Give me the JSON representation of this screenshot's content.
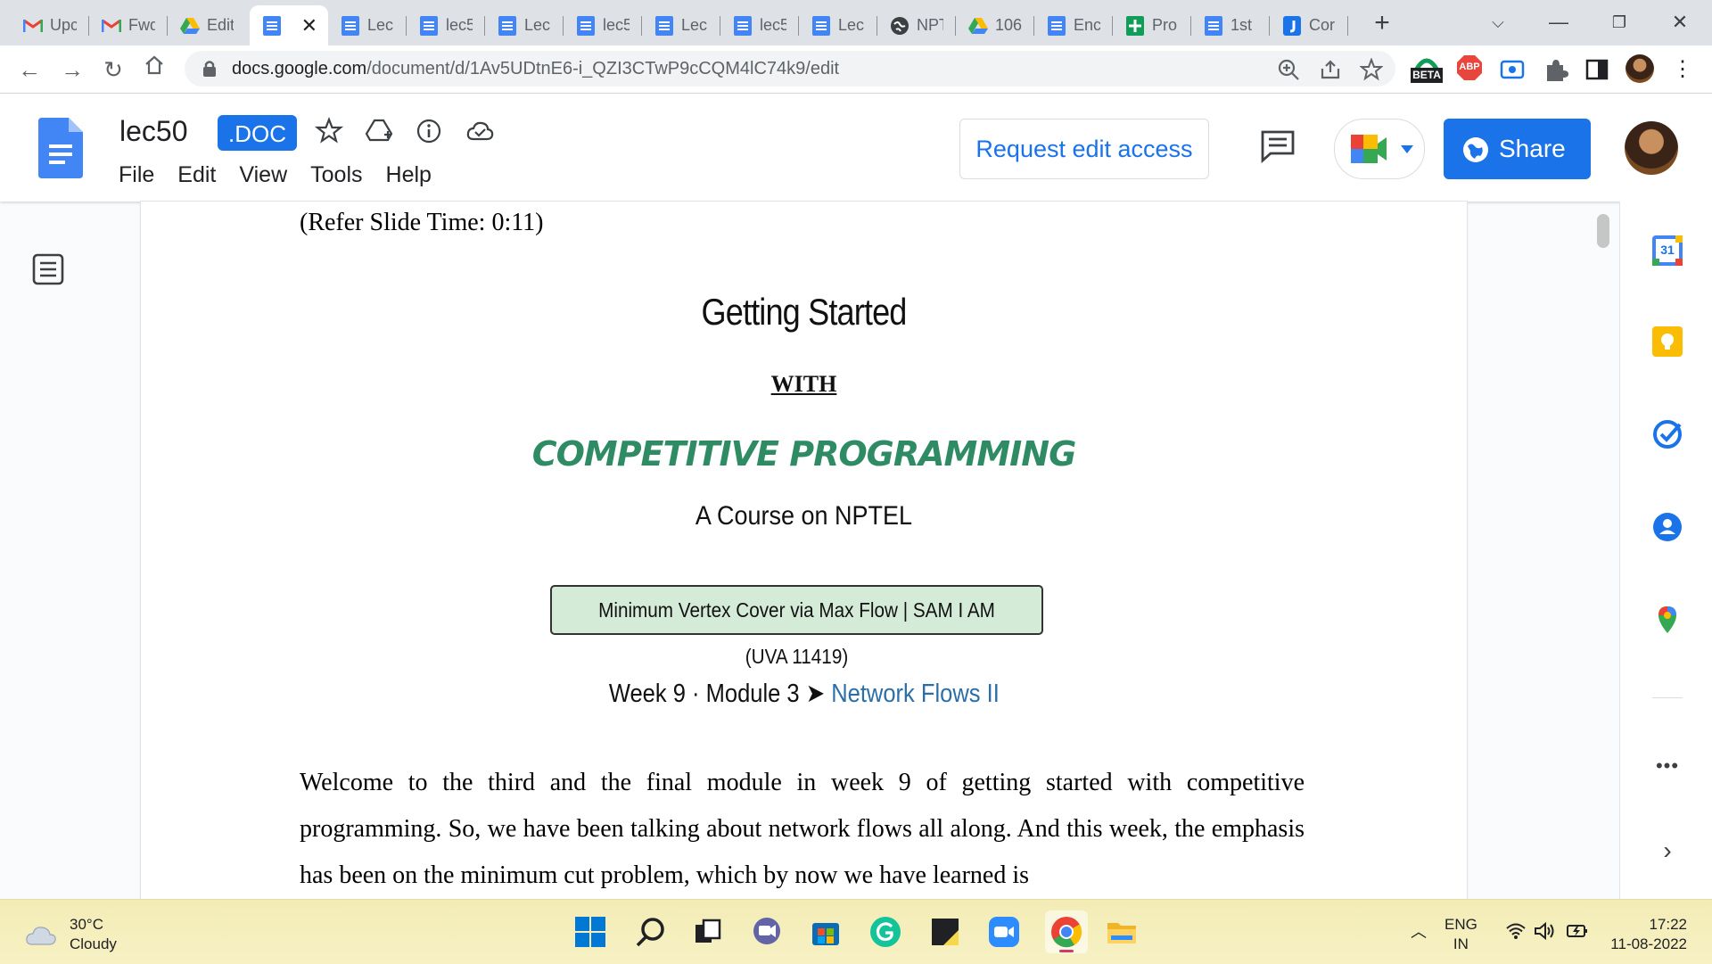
{
  "browser": {
    "tabs": [
      {
        "label": "Upc",
        "icon": "gmail-icon"
      },
      {
        "label": "Fwd",
        "icon": "gmail-icon"
      },
      {
        "label": "Edit",
        "icon": "google-drive-icon"
      },
      {
        "label": "",
        "icon": "google-docs-icon",
        "active": true
      },
      {
        "label": "Lec",
        "icon": "google-docs-icon"
      },
      {
        "label": "lec5",
        "icon": "google-docs-icon"
      },
      {
        "label": "Lec",
        "icon": "google-docs-icon"
      },
      {
        "label": "lec5",
        "icon": "google-docs-icon"
      },
      {
        "label": "Lec",
        "icon": "google-docs-icon"
      },
      {
        "label": "lec5",
        "icon": "google-docs-icon"
      },
      {
        "label": "Lec",
        "icon": "google-docs-icon"
      },
      {
        "label": "NPT",
        "icon": "globe-icon"
      },
      {
        "label": "106",
        "icon": "google-drive-icon"
      },
      {
        "label": "Enc",
        "icon": "google-docs-icon"
      },
      {
        "label": "Pro",
        "icon": "google-sheets-icon"
      },
      {
        "label": "1st",
        "icon": "google-docs-icon"
      },
      {
        "label": "Cor",
        "icon": "jamboard-icon"
      }
    ],
    "url_host": "docs.google.com",
    "url_path": "/document/d/1Av5UDtnE6-i_QZI3CTwP9cCQM4lC74k9/edit",
    "ext_badge": "BETA",
    "abp_label": "ABP"
  },
  "docs": {
    "title": "lec50",
    "badge": ".DOC",
    "menu": [
      "File",
      "Edit",
      "View",
      "Tools",
      "Help"
    ],
    "request_edit": "Request edit access",
    "share": "Share"
  },
  "document": {
    "refer": "(Refer Slide Time: 0:11)",
    "slide": {
      "title": "Getting Started",
      "with": "WITH",
      "subject": "Competitive Programming",
      "course": "A Course on NPTEL",
      "topic": "Minimum Vertex Cover via Max Flow |  SAM I AM (UVA 11419)",
      "week": "Week 9",
      "dot": "·",
      "module": "Module 3",
      "arrow": "➤",
      "module_title": "Network Flows II"
    },
    "paragraph": "Welcome to the third and the final module in week 9 of getting started with competitive programming. So, we have been talking about network flows all along. And this week, the emphasis has been on the minimum cut problem, which by now we have learned is"
  },
  "sidepanel": {
    "calendar_day": "31"
  },
  "taskbar": {
    "weather_temp": "30°C",
    "weather_desc": "Cloudy",
    "lang_1": "ENG",
    "lang_2": "IN",
    "time": "17:22",
    "date": "11-08-2022"
  },
  "colors": {
    "accent": "#1a73e8",
    "slide_green": "#2e8b63",
    "topic_box": "#d4ebd8",
    "taskbar": "#f5efc0"
  }
}
